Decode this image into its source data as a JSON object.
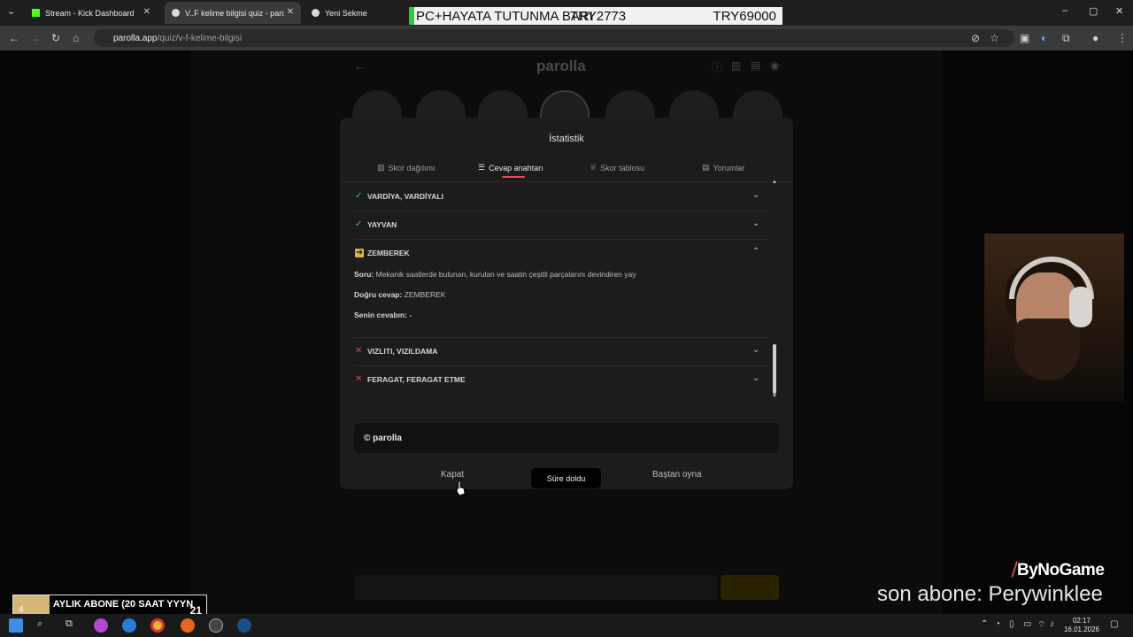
{
  "browser": {
    "tabs": [
      {
        "title": "Stream - Kick Dashboard",
        "fav_color": "#53fc18"
      },
      {
        "title": "V..F kelime bilgisi quiz - parolla",
        "fav_color": "#d9d9d9"
      },
      {
        "title": "Yeni Sekme",
        "fav_color": "#d9d9d9"
      }
    ],
    "url_host": "parolla.app",
    "url_path": "/quiz/v-f-kelime-bilgisi"
  },
  "overlay_title": {
    "left": "PC+HAYATA TUTUNMA BARI",
    "middle": "TRY2773",
    "right": "TRY69000"
  },
  "app": {
    "logo": "parolla"
  },
  "modal": {
    "title": "İstatistik",
    "tabs": [
      {
        "label": "Skor dağılımı",
        "icon": "chart-icon"
      },
      {
        "label": "Cevap anahtarı",
        "icon": "list-icon",
        "active": true
      },
      {
        "label": "Skor tablosu",
        "icon": "trophy-icon"
      },
      {
        "label": "Yorumlar",
        "icon": "comment-icon"
      }
    ],
    "rows": [
      {
        "status": "correct",
        "label": "VARDİYA, VARDİYALI"
      },
      {
        "status": "correct",
        "label": "YAYVAN"
      },
      {
        "status": "pass",
        "label": "ZEMBEREK",
        "expanded": true
      },
      {
        "status": "wrong",
        "label": "VIZLITI, VIZILDAMA"
      },
      {
        "status": "wrong",
        "label": "FERAGAT, FERAGAT ETME"
      }
    ],
    "detail": {
      "question_key": "Soru:",
      "question": "Mekanik saatlerde bulunan, kurulan ve saatin çeşitli parçalarını devindiren yay",
      "answer_key": "Doğru cevap:",
      "answer": "ZEMBEREK",
      "user_key": "Senin cevabın:",
      "user": "-"
    },
    "footer": "© parolla",
    "buttons": {
      "close": "Kapat",
      "status": "Süre doldu",
      "restart": "Baştan oyna"
    }
  },
  "stream": {
    "brand": "ByNoGame",
    "last_sub": "son abone: Perywinklee",
    "goal_text": "AYLIK ABONE (20 SAAT YYYN",
    "goal_start": "4",
    "goal_end": "21",
    "goal_progress": 0.19
  },
  "taskbar": {
    "time": "02:17",
    "date": "16.01.2026"
  },
  "colors": {
    "accent": "#e94b5b",
    "correct": "#2ec866",
    "wrong": "#e64545",
    "pass": "#e0b23a"
  }
}
